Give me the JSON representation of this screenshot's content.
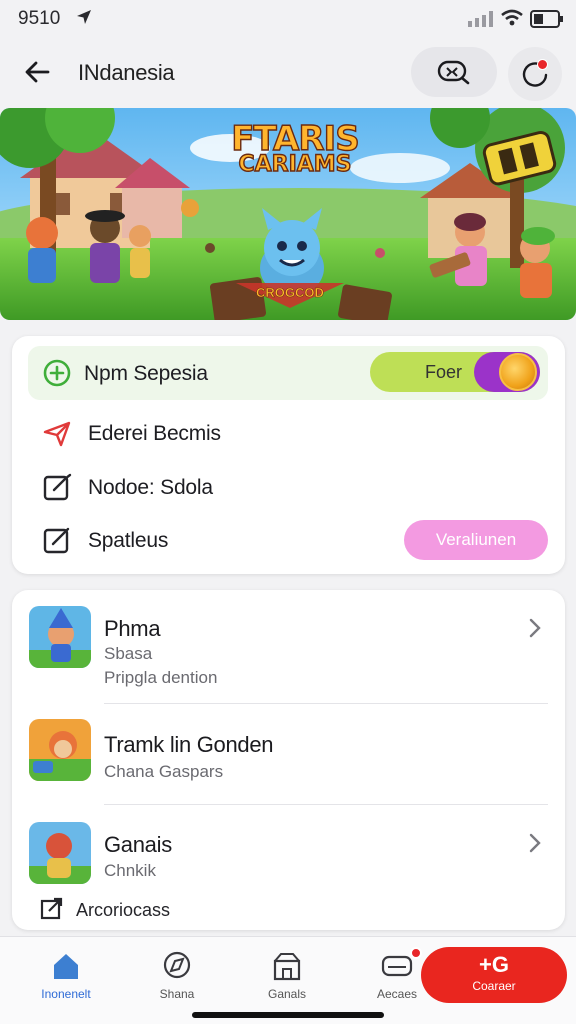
{
  "status_bar": {
    "time": "9510"
  },
  "header": {
    "title": "INdanesia"
  },
  "banner": {
    "logo_line1": "FTARIS",
    "logo_line2": "CARIAMS",
    "sub_text": "CROGCOD"
  },
  "settings": {
    "rows": [
      {
        "label": "Npm Sepesia",
        "icon": "plus-circle-icon"
      },
      {
        "label": "Ederei Becmis",
        "icon": "paper-plane-icon"
      },
      {
        "label": "Nodoe: Sdola",
        "icon": "edit-box-icon"
      },
      {
        "label": "Spatleus",
        "icon": "edit-box-icon"
      }
    ],
    "toggle_label": "Foer",
    "action_button": "Veraliunen"
  },
  "games": [
    {
      "title": "Phma",
      "subtitle1": "Sbasa",
      "subtitle2": "Pripgla dention",
      "has_chevron": true
    },
    {
      "title": "Tramk lin Gonden",
      "subtitle1": "Chana Gaspars",
      "has_chevron": false
    },
    {
      "title": "Ganais",
      "subtitle1": "Chnkik",
      "has_chevron": true
    }
  ],
  "footer_link": "Arcoriocass",
  "nav": {
    "items": [
      {
        "label": "Inonenelt",
        "icon": "home-icon"
      },
      {
        "label": "Shana",
        "icon": "map-icon"
      },
      {
        "label": "Ganals",
        "icon": "store-icon"
      },
      {
        "label": "Aecaes",
        "icon": "chat-icon"
      }
    ],
    "cta_top": "+G",
    "cta_label": "Coaraer"
  },
  "colors": {
    "accent": "#2f6bd6",
    "cta": "#e9261f",
    "toggle": "#bedf56",
    "toggle_knob": "#9b33c9",
    "pill": "#f39ae1"
  }
}
